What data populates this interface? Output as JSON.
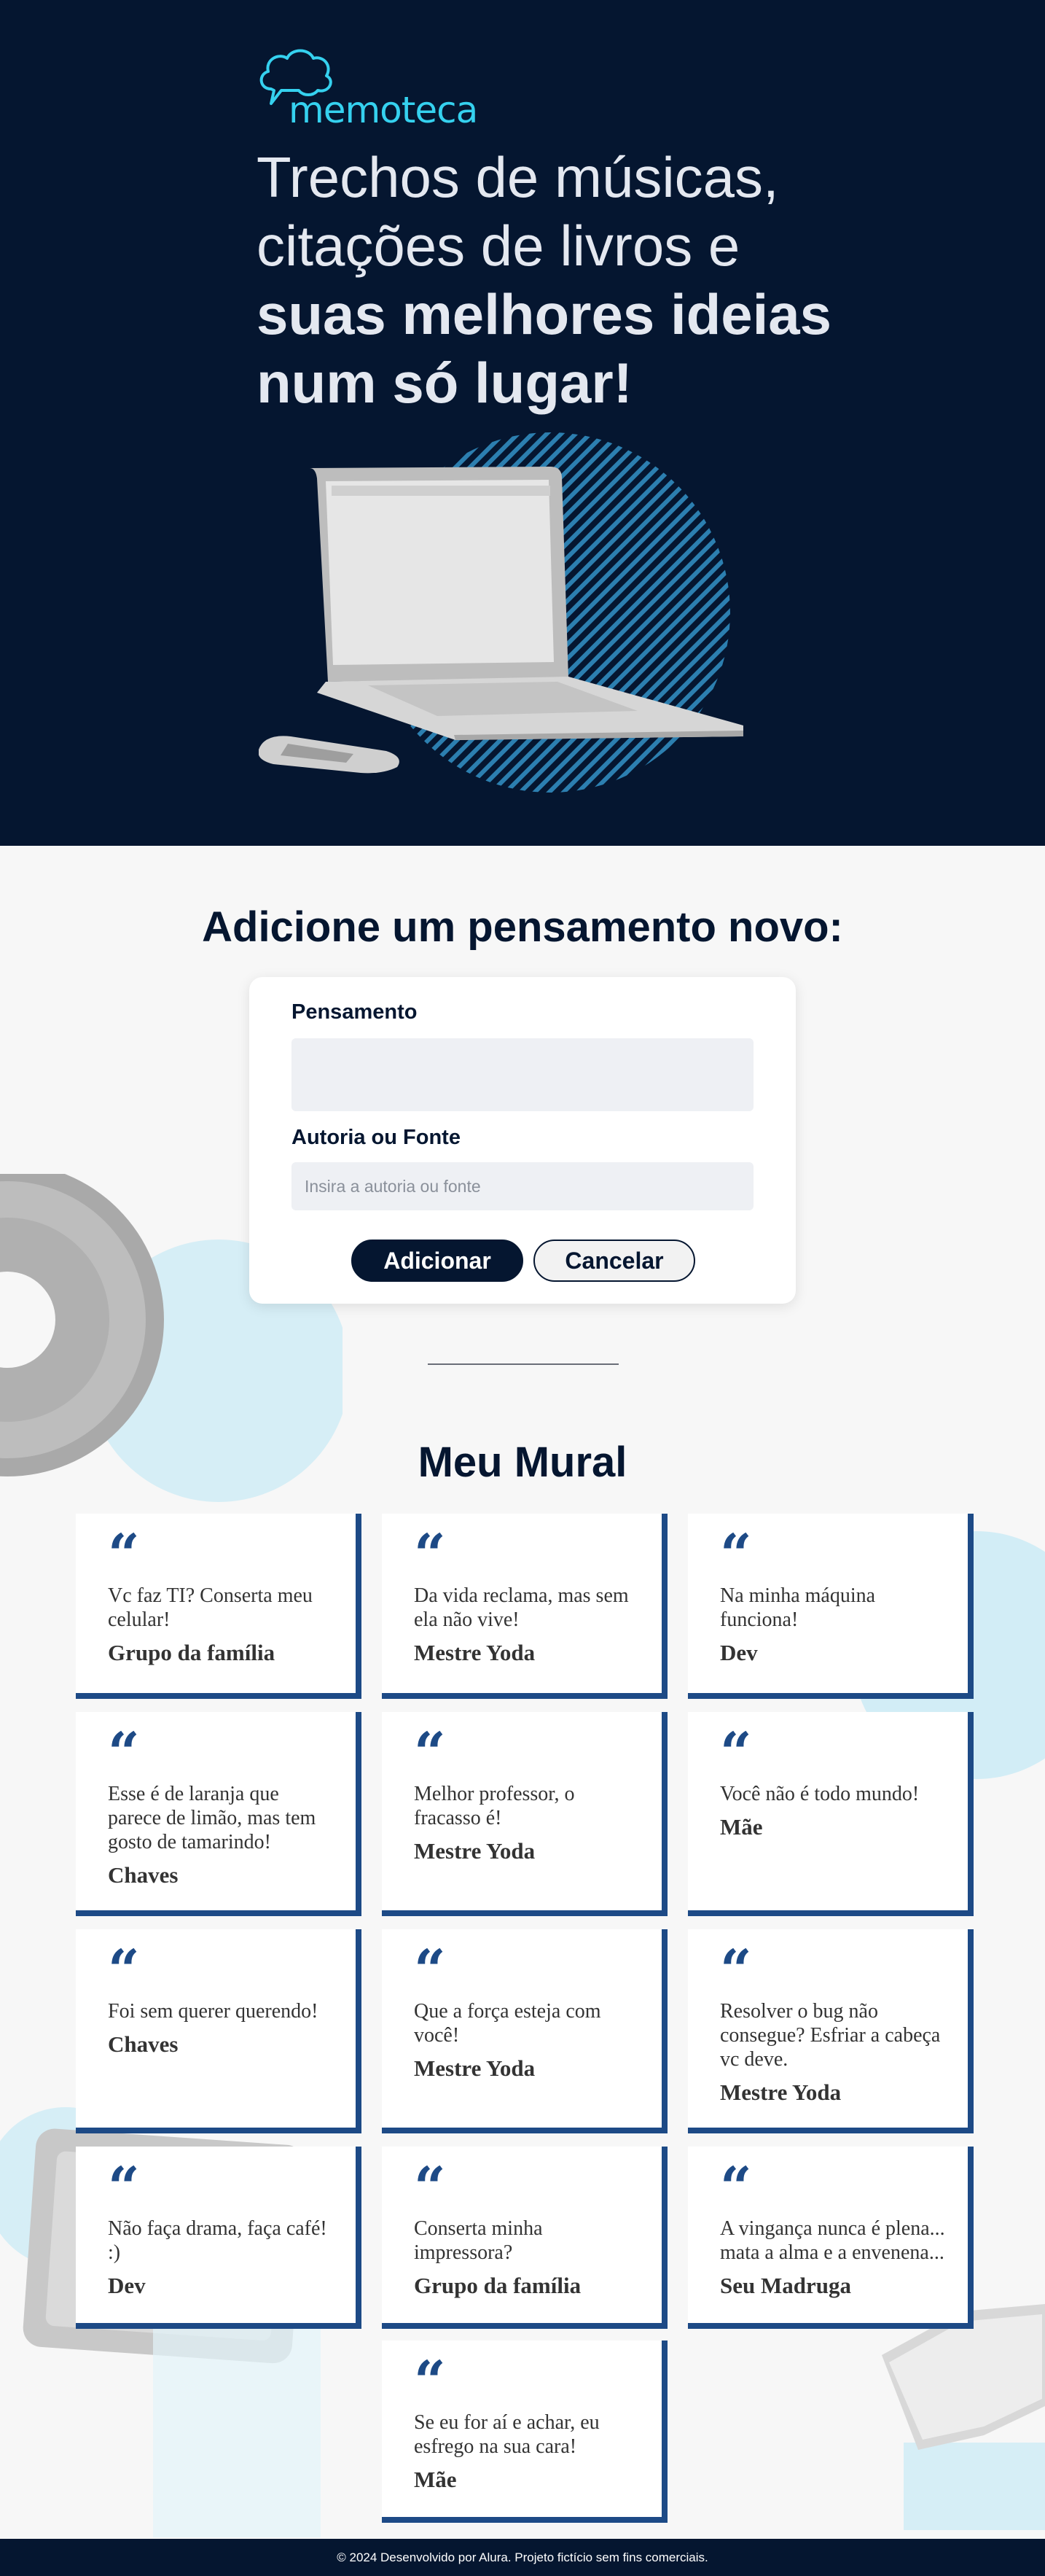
{
  "brand": {
    "name": "memoteca"
  },
  "hero": {
    "line1": "Trechos de músicas,",
    "line2": "citações de livros e",
    "line3": "suas melhores ideias",
    "line4": "num só lugar!"
  },
  "form": {
    "title": "Adicione um pensamento novo:",
    "thought_label": "Pensamento",
    "thought_value": "",
    "author_label": "Autoria ou Fonte",
    "author_placeholder": "Insira a autoria ou fonte",
    "author_value": "",
    "add_label": "Adicionar",
    "cancel_label": "Cancelar"
  },
  "mural": {
    "title": "Meu Mural",
    "quote_glyph": "“",
    "cards": [
      {
        "text": "Vc faz TI? Conserta meu celular!",
        "author": "Grupo da família"
      },
      {
        "text": "Da vida reclama, mas sem ela não vive!",
        "author": "Mestre Yoda"
      },
      {
        "text": "Na minha máquina funciona!",
        "author": "Dev"
      },
      {
        "text": "Esse é de laranja que parece de limão, mas tem gosto de tamarindo!",
        "author": "Chaves"
      },
      {
        "text": "Melhor professor, o fracasso é!",
        "author": "Mestre Yoda"
      },
      {
        "text": "Você não é todo mundo!",
        "author": "Mãe"
      },
      {
        "text": "Foi sem querer querendo!",
        "author": "Chaves"
      },
      {
        "text": "Que a força esteja com você!",
        "author": "Mestre Yoda"
      },
      {
        "text": "Resolver o bug não consegue? Esfriar a cabeça vc deve.",
        "author": "Mestre Yoda"
      },
      {
        "text": "Não faça drama, faça café! :)",
        "author": "Dev"
      },
      {
        "text": "Conserta minha impressora?",
        "author": "Grupo da família"
      },
      {
        "text": "A vingança nunca é plena... mata a alma e a envenena...",
        "author": "Seu Madruga"
      },
      {
        "text": "Se eu for aí e achar, eu esfrego na sua cara!",
        "author": "Mãe"
      }
    ]
  },
  "footer": {
    "text": "© 2024 Desenvolvido por Alura. Projeto fictício sem fins comerciais."
  },
  "colors": {
    "navy": "#051630",
    "accent": "#35D1EF",
    "card_border": "#1D4A86",
    "background": "#F7F7F7"
  }
}
